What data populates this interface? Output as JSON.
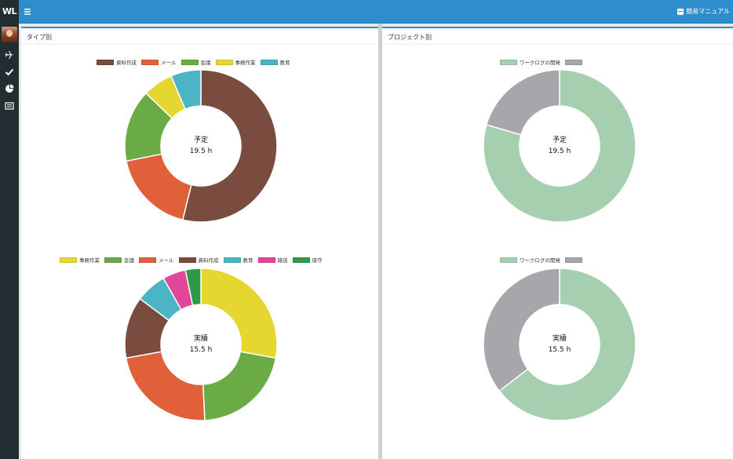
{
  "header": {
    "brand": "WL",
    "manual_label": "簡易マニュアル"
  },
  "sidebar": {
    "items": [
      {
        "icon": "plane-icon"
      },
      {
        "icon": "check-icon"
      },
      {
        "icon": "pie-chart-icon"
      },
      {
        "icon": "list-icon"
      }
    ]
  },
  "panels": {
    "left_title": "タイプ別",
    "right_title": "プロジェクト別"
  },
  "chart_data": [
    {
      "type": "pie",
      "center_title": "予定",
      "center_value": "19.5 h",
      "categories": [
        "資料作成",
        "メール",
        "会議",
        "事務作業",
        "教育"
      ],
      "values": [
        10.5,
        3.5,
        3.0,
        1.25,
        1.25
      ],
      "colors": [
        "#7a4b3f",
        "#e0603a",
        "#6aab45",
        "#e5d630",
        "#4cb5c5"
      ]
    },
    {
      "type": "pie",
      "center_title": "実績",
      "center_value": "15.5 h",
      "categories": [
        "事務作業",
        "会議",
        "メール",
        "資料作成",
        "教育",
        "雑談",
        "保守"
      ],
      "values": [
        4.25,
        3.25,
        3.5,
        2.0,
        1.0,
        0.75,
        0.5
      ],
      "colors": [
        "#e5d630",
        "#6aab45",
        "#e0603a",
        "#7a4b3f",
        "#4cb5c5",
        "#e0479b",
        "#2f9a47"
      ]
    },
    {
      "type": "pie",
      "center_title": "予定",
      "center_value": "19.5 h",
      "categories": [
        "ワークログの開発",
        ""
      ],
      "values": [
        15.5,
        4.0
      ],
      "colors": [
        "#a5cfae",
        "#a8a6aa"
      ]
    },
    {
      "type": "pie",
      "center_title": "実績",
      "center_value": "15.5 h",
      "categories": [
        "ワークログの開発",
        ""
      ],
      "values": [
        10.0,
        5.5
      ],
      "colors": [
        "#a5cfae",
        "#a8a6aa"
      ]
    }
  ]
}
